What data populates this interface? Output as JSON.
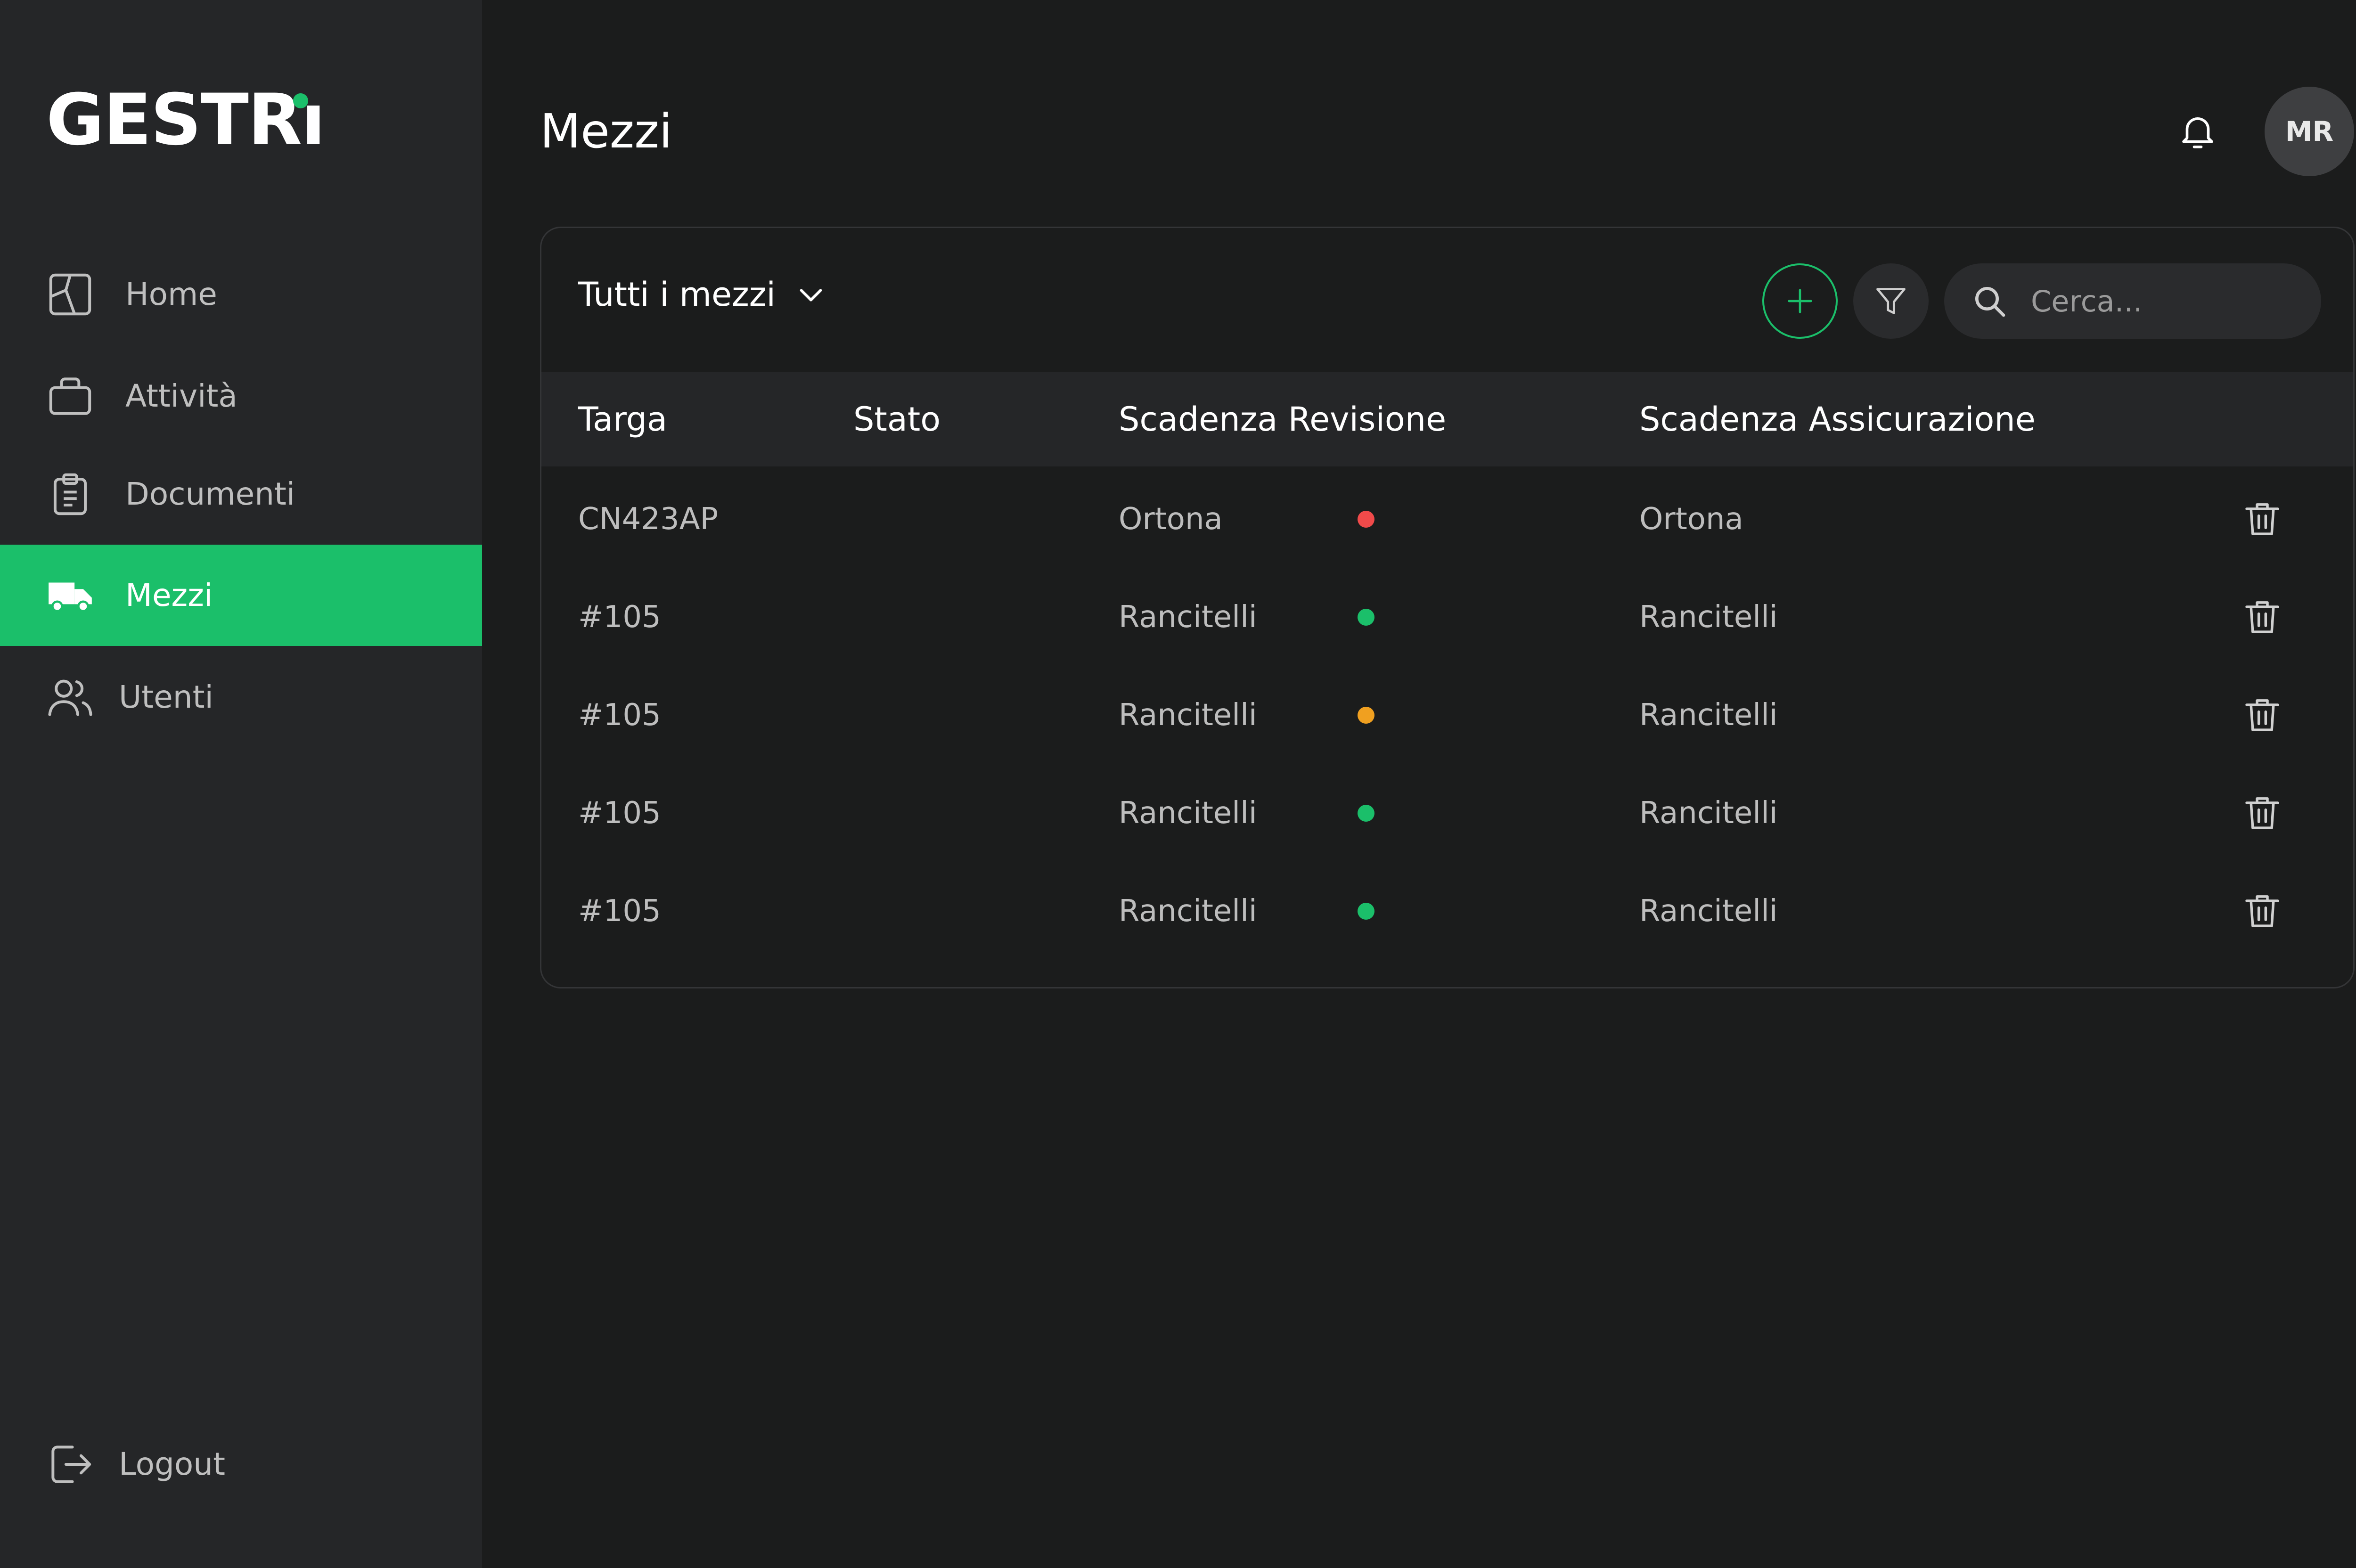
{
  "app": {
    "logo": "GESTRi",
    "logo_accent": "#1bbf6a"
  },
  "sidebar": {
    "items": [
      {
        "label": "Home",
        "icon": "layout-icon",
        "active": false
      },
      {
        "label": "Attività",
        "icon": "briefcase-icon",
        "active": false
      },
      {
        "label": "Documenti",
        "icon": "clipboard-icon",
        "active": false
      },
      {
        "label": "Mezzi",
        "icon": "truck-icon",
        "active": true
      },
      {
        "label": "Utenti",
        "icon": "users-icon",
        "active": false
      }
    ],
    "logout": {
      "label": "Logout",
      "icon": "logout-icon"
    }
  },
  "header": {
    "title": "Mezzi",
    "avatar_initials": "MR"
  },
  "card": {
    "filter_label": "Tutti i mezzi",
    "search_placeholder": "Cerca...",
    "columns": [
      "Targa",
      "Stato",
      "Scadenza Revisione",
      "Scadenza Assicurazione"
    ],
    "rows": [
      {
        "targa": "CN423AP",
        "stato": "red",
        "revisione": "Ortona",
        "assicurazione": "Ortona"
      },
      {
        "targa": "#105",
        "stato": "green",
        "revisione": "Rancitelli",
        "assicurazione": "Rancitelli"
      },
      {
        "targa": "#105",
        "stato": "orange",
        "revisione": "Rancitelli",
        "assicurazione": "Rancitelli"
      },
      {
        "targa": "#105",
        "stato": "green",
        "revisione": "Rancitelli",
        "assicurazione": "Rancitelli"
      },
      {
        "targa": "#105",
        "stato": "green",
        "revisione": "Rancitelli",
        "assicurazione": "Rancitelli"
      }
    ]
  },
  "colors": {
    "accent": "#1bbf6a",
    "status_red": "#f04a4a",
    "status_green": "#1bbf6a",
    "status_orange": "#f0a020"
  }
}
